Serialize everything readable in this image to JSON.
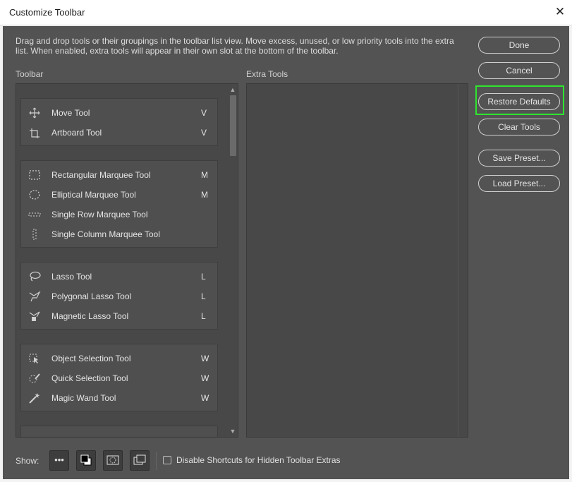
{
  "window": {
    "title": "Customize Toolbar",
    "close_glyph": "✕"
  },
  "description": "Drag and drop tools or their groupings in the toolbar list view. Move excess, unused, or low priority tools into the extra list. When enabled, extra tools will appear in their own slot at the bottom of the toolbar.",
  "toolbar_label": "Toolbar",
  "extra_label": "Extra Tools",
  "groups": [
    {
      "tools": [
        {
          "name": "Move Tool",
          "key": "V",
          "icon": "move-icon"
        },
        {
          "name": "Artboard Tool",
          "key": "V",
          "icon": "artboard-icon"
        }
      ]
    },
    {
      "tools": [
        {
          "name": "Rectangular Marquee Tool",
          "key": "M",
          "icon": "rect-marquee-icon"
        },
        {
          "name": "Elliptical Marquee Tool",
          "key": "M",
          "icon": "ellipse-marquee-icon"
        },
        {
          "name": "Single Row Marquee Tool",
          "key": "",
          "icon": "row-marquee-icon"
        },
        {
          "name": "Single Column Marquee Tool",
          "key": "",
          "icon": "column-marquee-icon"
        }
      ]
    },
    {
      "tools": [
        {
          "name": "Lasso Tool",
          "key": "L",
          "icon": "lasso-icon"
        },
        {
          "name": "Polygonal Lasso Tool",
          "key": "L",
          "icon": "polygonal-lasso-icon"
        },
        {
          "name": "Magnetic Lasso Tool",
          "key": "L",
          "icon": "magnetic-lasso-icon"
        }
      ]
    },
    {
      "tools": [
        {
          "name": "Object Selection Tool",
          "key": "W",
          "icon": "object-selection-icon"
        },
        {
          "name": "Quick Selection Tool",
          "key": "W",
          "icon": "quick-selection-icon"
        },
        {
          "name": "Magic Wand Tool",
          "key": "W",
          "icon": "magic-wand-icon"
        }
      ]
    }
  ],
  "buttons": {
    "done": "Done",
    "cancel": "Cancel",
    "restore": "Restore Defaults",
    "clear": "Clear Tools",
    "save": "Save Preset...",
    "load": "Load Preset..."
  },
  "bottom": {
    "show_label": "Show:",
    "show_buttons": [
      "more-dots-icon",
      "fg-bg-color-icon",
      "quick-mask-icon",
      "screen-mode-icon"
    ],
    "checkbox_label": "Disable Shortcuts for Hidden Toolbar Extras",
    "checkbox_checked": false
  },
  "highlight_color": "#2ee52e"
}
